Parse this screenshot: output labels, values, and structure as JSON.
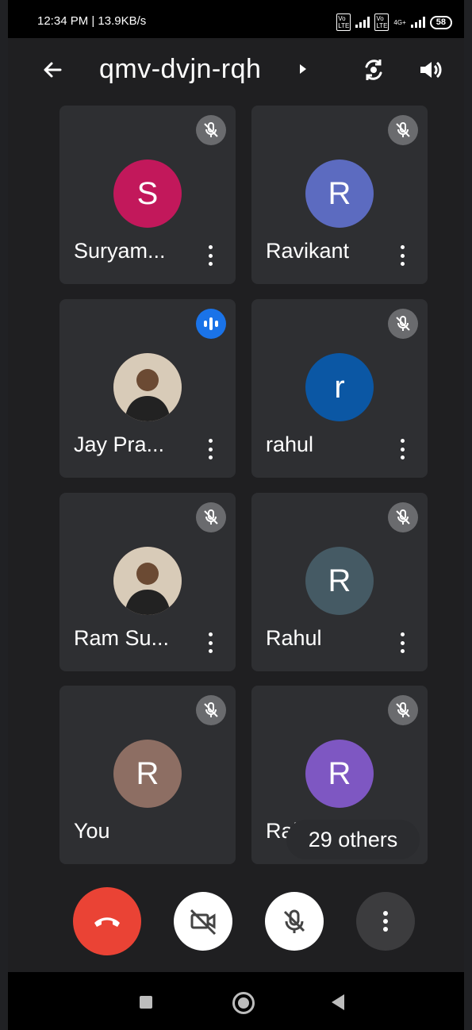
{
  "status_bar": {
    "time_speed": "12:34 PM | 13.9KB/s",
    "battery": "58",
    "net_label": "4G+"
  },
  "header": {
    "meeting_code": "qmv-dvjn-rqh"
  },
  "participants": [
    {
      "name": "Suryam...",
      "initial": "S",
      "color": "#c2185b",
      "audio": "muted"
    },
    {
      "name": "Ravikant",
      "initial": "R",
      "color": "#5c6bc0",
      "audio": "muted"
    },
    {
      "name": "Jay Pra...",
      "initial": "",
      "color": "#6d4c41",
      "audio": "speaking"
    },
    {
      "name": "rahul",
      "initial": "r",
      "color": "#0b57a4",
      "audio": "muted"
    },
    {
      "name": "Ram Su...",
      "initial": "",
      "color": "#5d4037",
      "audio": "muted"
    },
    {
      "name": "Rahul",
      "initial": "R",
      "color": "#455a64",
      "audio": "muted"
    },
    {
      "name": "You",
      "initial": "R",
      "color": "#8d6e63",
      "audio": "muted"
    },
    {
      "name": "Rahul",
      "initial": "R",
      "color": "#7e57c2",
      "audio": "muted"
    }
  ],
  "others_label": "29 others",
  "controls": {
    "end_call_icon": "phone-hangup-icon",
    "camera_icon": "camera-off-icon",
    "mic_icon": "mic-off-icon",
    "menu_icon": "more-vertical-icon"
  },
  "colors": {
    "end_call": "#ea4335",
    "speaking": "#1a73e8",
    "tile": "#2e2f32"
  }
}
